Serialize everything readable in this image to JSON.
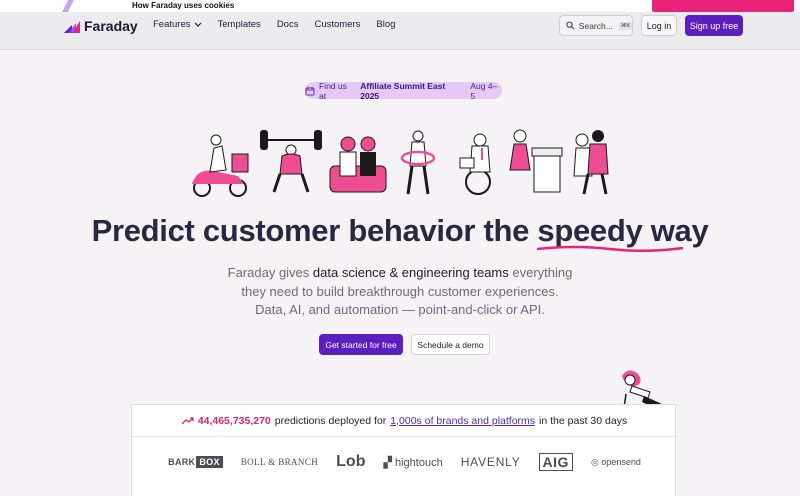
{
  "cookie_banner": {
    "text": "How Faraday uses cookies"
  },
  "nav": {
    "brand": "Faraday",
    "links": [
      "Features",
      "Templates",
      "Docs",
      "Customers",
      "Blog"
    ],
    "search_label": "Search...",
    "search_shortcut": "⌘K",
    "login": "Log in",
    "signup": "Sign up free"
  },
  "announcement": {
    "prefix": "Find us at",
    "event": "Affiliate Summit East 2025",
    "dates": "Aug 4–5"
  },
  "hero": {
    "headline_before": "Predict customer behavior the ",
    "headline_highlight": "speedy way",
    "sub_part1": "Faraday gives ",
    "sub_bold": "data science & engineering teams",
    "sub_part2": " everything",
    "sub_line2": "they need to build breakthrough customer experiences.",
    "sub_line3": "Data, AI, and automation — point-and-click or API.",
    "cta_primary": "Get started for free",
    "cta_secondary": "Schedule a demo"
  },
  "stats": {
    "count": "44,465,735,270",
    "text1": "predictions deployed for",
    "link": "1,000s of brands and platforms",
    "text2": "in the past 30 days"
  },
  "logos": [
    "BARK",
    "BOX",
    "BOLL & BRANCH",
    "Lob",
    "hightouch",
    "HAVENLY",
    "AIG",
    "opensend"
  ],
  "colors": {
    "primary": "#5b1fbf",
    "accent": "#e8247a"
  }
}
